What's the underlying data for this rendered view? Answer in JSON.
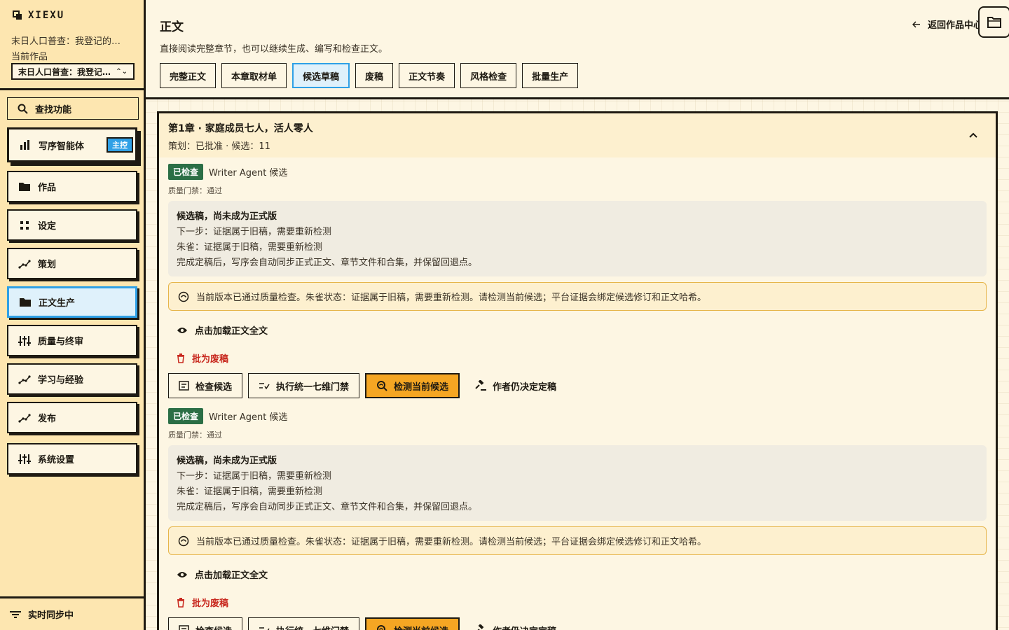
{
  "brand": {
    "name": "XIEXU"
  },
  "project": {
    "title": "末日人口普查：我登记的…",
    "label": "当前作品",
    "select_value": "末日人口普查：我登记…"
  },
  "sidebar": {
    "search_label": "查找功能",
    "items": [
      {
        "label": "写序智能体",
        "badge": "主控",
        "icon": "bar-chart-icon"
      },
      {
        "label": "作品",
        "icon": "folder-icon"
      },
      {
        "label": "设定",
        "icon": "grid-icon"
      },
      {
        "label": "策划",
        "icon": "trend-icon"
      },
      {
        "label": "正文生产",
        "icon": "folder-icon"
      },
      {
        "label": "质量与终审",
        "icon": "sliders-icon"
      },
      {
        "label": "学习与经验",
        "icon": "trend-icon"
      },
      {
        "label": "发布",
        "icon": "trend-icon"
      },
      {
        "label": "系统设置",
        "icon": "sliders-icon"
      }
    ],
    "sync_label": "实时同步中"
  },
  "header": {
    "title": "正文",
    "subtitle": "直接阅读完整章节，也可以继续生成、编写和检查正文。",
    "back_label": "返回作品中心",
    "tabs": [
      "完整正文",
      "本章取材单",
      "候选草稿",
      "废稿",
      "正文节奏",
      "风格检查",
      "批量生产"
    ],
    "active_tab": "候选草稿"
  },
  "chapter": {
    "title": "第1章 · 家庭成员七人，活人零人",
    "meta": "策划：已批准 · 候选：11",
    "candidates": [
      {
        "status": "已检查",
        "name": "Writer Agent 候选",
        "gate": "质量门禁：通过",
        "box_title": "候选稿，尚未成为正式版",
        "lines": [
          "下一步：证据属于旧稿，需要重新检测",
          "朱雀：证据属于旧稿，需要重新检测",
          "完成定稿后，写序会自动同步正式正文、章节文件和合集，并保留回退点。"
        ],
        "alert": "当前版本已通过质量检查。朱雀状态：证据属于旧稿，需要重新检测。请检测当前候选；平台证据会绑定候选修订和正文哈希。",
        "load_label": "点击加载正文全文",
        "discard_label": "批为废稿",
        "actions": [
          "检查候选",
          "执行统一七维门禁",
          "检测当前候选",
          "作者仍决定定稿"
        ]
      },
      {
        "status": "已检查",
        "name": "Writer Agent 候选",
        "gate": "质量门禁：通过",
        "box_title": "候选稿，尚未成为正式版",
        "lines": [
          "下一步：证据属于旧稿，需要重新检测",
          "朱雀：证据属于旧稿，需要重新检测",
          "完成定稿后，写序会自动同步正式正文、章节文件和合集，并保留回退点。"
        ],
        "alert": "当前版本已通过质量检查。朱雀状态：证据属于旧稿，需要重新检测。请检测当前候选；平台证据会绑定候选修订和正文哈希。",
        "load_label": "点击加载正文全文",
        "discard_label": "批为废稿",
        "actions": [
          "检查候选",
          "执行统一七维门禁",
          "检测当前候选",
          "作者仍决定定稿"
        ]
      }
    ]
  },
  "colors": {
    "accent": "#2fa0e6",
    "warning": "#f5a623",
    "danger": "#c8281e",
    "success": "#2b6e45"
  }
}
